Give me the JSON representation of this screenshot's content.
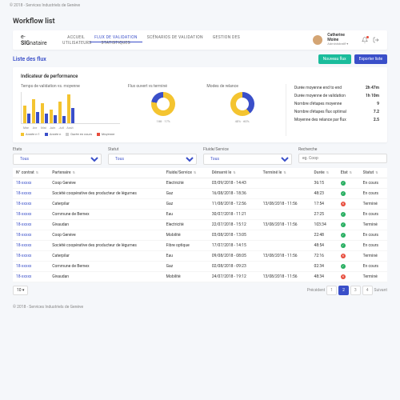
{
  "copyright": "© 2018 - Services Industriels de Genève",
  "page_title": "Workflow list",
  "brand_prefix": "e-",
  "brand_bold": "SIG",
  "brand_suffix": "nataire",
  "nav": [
    "ACCUEIL",
    "FLUX DE VALIDATION",
    "SCÉNARIOS DE VALIDATION",
    "GESTION DES UTILISATEURS",
    "STATISTIQUES"
  ],
  "nav_active_index": 1,
  "user": {
    "name": "Catherine Moine",
    "role": "Administratif"
  },
  "sub_title": "Liste des flux",
  "buttons": {
    "new": "Nouveau flux",
    "export": "Exporter liste"
  },
  "kpi_card_title": "Indicateur de performance",
  "chart1": {
    "title": "Temps de validation vs. moyenne",
    "legend": [
      "Année n-1",
      "Année n",
      "Durée en cours",
      "Moyenne"
    ]
  },
  "chart2": {
    "title": "Flux ouvert vs terminé",
    "stats": "188 · 17%"
  },
  "chart3": {
    "title": "Modes de relance",
    "stats": "40% · 60%"
  },
  "kpis": [
    {
      "label": "Durée moyenne end to end",
      "value": "2h 47m"
    },
    {
      "label": "Durée moyenne de validation",
      "value": "1h 10m"
    },
    {
      "label": "Nombre d'étapes moyenne",
      "value": "9"
    },
    {
      "label": "Nombre d'étapes flux optimal",
      "value": "7.2"
    },
    {
      "label": "Moyenne des relance par flux",
      "value": "2.5"
    }
  ],
  "filters": {
    "etats": {
      "label": "Etats",
      "value": "Tous"
    },
    "statut": {
      "label": "Statut",
      "value": "Tous"
    },
    "fluide": {
      "label": "Fluide/Service",
      "value": "Tous"
    },
    "recherche": {
      "label": "Recherche",
      "placeholder": "eg. Coop"
    }
  },
  "columns": [
    "N° contrat",
    "Partenaire",
    "Fluide/Service",
    "Démarré le",
    "Terminé le",
    "Durée",
    "Etat",
    "Statut"
  ],
  "rows": [
    {
      "c": "18-xxxxx",
      "p": "Coop Genève",
      "f": "Electricité",
      "d": "03/09/2018 - 14:43",
      "t": "",
      "du": "36:15",
      "e": "ok",
      "s": "En cours"
    },
    {
      "c": "18-xxxxx",
      "p": "Société coopérative des producteur de légumes",
      "f": "Gaz",
      "d": "16/08/2018 - 18:36",
      "t": "",
      "du": "48:23",
      "e": "ok",
      "s": "En cours"
    },
    {
      "c": "18-xxxxx",
      "p": "Caterpilar",
      "f": "Gaz",
      "d": "11/08/2018 - 12:56",
      "t": "13/08/2018 - 11:56",
      "du": "17:54",
      "e": "no",
      "s": "Terminé"
    },
    {
      "c": "18-xxxxx",
      "p": "Commune de Bernex",
      "f": "Eau",
      "d": "30/07/2018 - 11:21",
      "t": "",
      "du": "27:25",
      "e": "ok",
      "s": "En cours"
    },
    {
      "c": "18-xxxxx",
      "p": "Givaudan",
      "f": "Electricité",
      "d": "22/07/2018 - 15:12",
      "t": "13/08/2018 - 11:56",
      "du": "103:34",
      "e": "ok",
      "s": "Terminé"
    },
    {
      "c": "18-xxxxx",
      "p": "Coop Genève",
      "f": "Mobilité",
      "d": "03/08/2018 - 13:05",
      "t": "",
      "du": "22:48",
      "e": "ok",
      "s": "En cours"
    },
    {
      "c": "18-xxxxx",
      "p": "Société coopérative des producteur de légumes",
      "f": "Fibre optique",
      "d": "17/07/2018 - 14:15",
      "t": "",
      "du": "48:54",
      "e": "ok",
      "s": "En cours"
    },
    {
      "c": "18-xxxxx",
      "p": "Caterpilar",
      "f": "Eau",
      "d": "09/08/2018 - 08:05",
      "t": "13/08/2018 - 11:56",
      "du": "72:16",
      "e": "no",
      "s": "Terminé"
    },
    {
      "c": "18-xxxxx",
      "p": "Commune de Bernex",
      "f": "Gaz",
      "d": "02/08/2018 - 09:23",
      "t": "",
      "du": "02:34",
      "e": "ok",
      "s": "En cours"
    },
    {
      "c": "18-xxxxx",
      "p": "Givaudan",
      "f": "Mobilité",
      "d": "24/07/2018 - 19:12",
      "t": "13/08/2018 - 11:56",
      "du": "48:34",
      "e": "no",
      "s": "Terminé"
    }
  ],
  "page_size": "10",
  "pagination": {
    "prev": "Précédent",
    "next": "Suivant",
    "pages": [
      "1",
      "2",
      "3",
      "4"
    ],
    "active": 1
  },
  "chart_data": {
    "bar": {
      "type": "bar",
      "categories": [
        "Mar",
        "Avr",
        "Mai",
        "Juin",
        "Juil",
        "Août"
      ],
      "series": [
        {
          "name": "Année n-1",
          "values": [
            90,
            120,
            100,
            70,
            110,
            145
          ]
        },
        {
          "name": "Année n",
          "values": [
            50,
            55,
            50,
            40,
            35,
            75
          ]
        }
      ],
      "ylim": [
        0,
        160
      ]
    },
    "donut1": {
      "type": "pie",
      "values": [
        83,
        17
      ]
    },
    "donut2": {
      "type": "pie",
      "values": [
        40,
        60
      ]
    }
  }
}
